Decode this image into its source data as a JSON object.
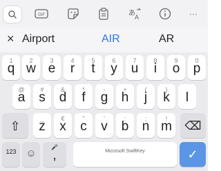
{
  "toolbar": {
    "icons": [
      "search-icon",
      "gif-icon",
      "sticker-icon",
      "clipboard-icon",
      "translate-icon",
      "info-icon",
      "more-icon"
    ],
    "gif_label": "GIF",
    "more_label": "···"
  },
  "suggestions": {
    "close_label": "×",
    "items": [
      "Airport",
      "AIR",
      "AR"
    ],
    "highlight_color": "#2b78e4"
  },
  "keys": {
    "row1": [
      {
        "hint": "1",
        "label": "q"
      },
      {
        "hint": "2",
        "label": "w"
      },
      {
        "hint": "3",
        "label": "e"
      },
      {
        "hint": "4",
        "label": "r"
      },
      {
        "hint": "5",
        "label": "t"
      },
      {
        "hint": "6",
        "label": "y"
      },
      {
        "hint": "7",
        "label": "u"
      },
      {
        "hint": "8",
        "label": "i"
      },
      {
        "hint": "9",
        "label": "o"
      },
      {
        "hint": "0",
        "label": "p"
      }
    ],
    "row2": [
      {
        "hint": "@",
        "label": "a"
      },
      {
        "hint": "#",
        "label": "s"
      },
      {
        "hint": "&",
        "label": "d"
      },
      {
        "hint": "*",
        "label": "f"
      },
      {
        "hint": "-",
        "label": "g"
      },
      {
        "hint": "+",
        "label": "h"
      },
      {
        "hint": "(",
        "label": "j"
      },
      {
        "hint": ")",
        "label": "k"
      },
      {
        "hint": "",
        "label": "l"
      }
    ],
    "row3": [
      {
        "hint": "_",
        "label": "z"
      },
      {
        "hint": "€",
        "label": "x"
      },
      {
        "hint": "\"",
        "label": "c"
      },
      {
        "hint": "'",
        "label": "v"
      },
      {
        "hint": ":",
        "label": "b"
      },
      {
        "hint": ";",
        "label": "n"
      },
      {
        "hint": "!",
        "label": "m"
      }
    ],
    "shift_label": "⇧",
    "backspace_label": "⌫",
    "numbers_label": "123",
    "emoji_label": "☺",
    "comma_hint": "🎤",
    "comma_label": ",",
    "space_label": "Microsoft SwiftKey",
    "period_hint": "?!",
    "period_label": ".",
    "enter_label": "✓"
  }
}
